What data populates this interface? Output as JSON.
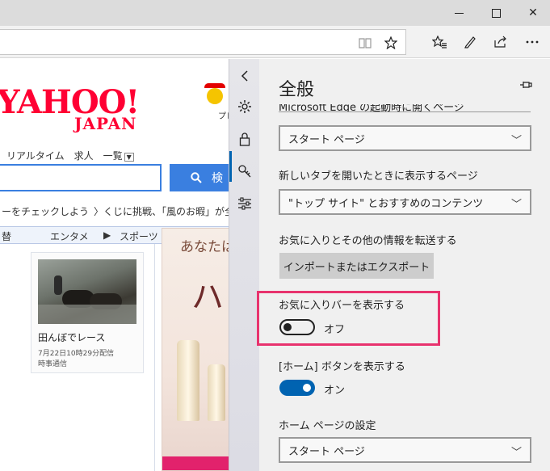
{
  "window": {
    "controls": {
      "minimize": "",
      "maximize": "",
      "close": "✕"
    }
  },
  "toolbar": {
    "reading_view_icon": "reading-view-icon",
    "favorite_icon": "star-icon",
    "hub_icon": "favorites-hub-icon",
    "notes_icon": "pen-icon",
    "share_icon": "share-icon",
    "more_icon": "more-icon"
  },
  "page": {
    "logo": "YAHOO!",
    "logo_sub": "JAPAN",
    "premium_label": "プレミア",
    "nav_links": [
      "リアルタイム",
      "求人",
      "一覧"
    ],
    "search_button": "検",
    "ticker": [
      "ーをチェックしよう",
      "〉くじに挑戦、「風のお暇」が全巻"
    ],
    "tabs": [
      "替",
      "エンタメ",
      "スポーツ"
    ],
    "news_card": {
      "title": "田んぼでレース",
      "date": "7月22日10時29分配信",
      "source": "時事通信"
    },
    "ad": {
      "headline": "あなたは",
      "char": "ハ"
    }
  },
  "settings": {
    "rail": [
      "back-chevron-icon",
      "gear-icon",
      "lock-icon",
      "key-icon",
      "sliders-icon"
    ],
    "title": "全般",
    "pin_icon": "pin-icon",
    "cutoff_label": "Microsoft Edge の起動時に開くページ",
    "startup_select": "スタート ページ",
    "newtab_label": "新しいタブを開いたときに表示するページ",
    "newtab_select": "\"トップ サイト\" とおすすめのコンテンツ",
    "transfer_label": "お気に入りとその他の情報を転送する",
    "import_button": "インポートまたはエクスポート",
    "favbar_label": "お気に入りバーを表示する",
    "favbar_state": "オフ",
    "home_label": "[ホーム] ボタンを表示する",
    "home_state": "オン",
    "homepage_label": "ホーム ページの設定",
    "homepage_select": "スタート ページ"
  },
  "colors": {
    "accent": "#0063b1",
    "highlight": "#e8336e",
    "yahoo_red": "#ff0033"
  }
}
